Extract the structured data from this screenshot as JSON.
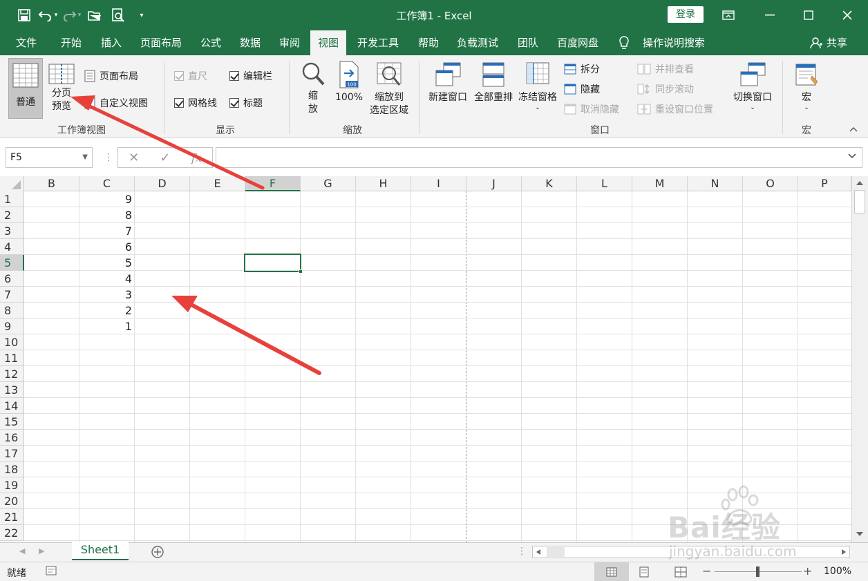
{
  "titlebar": {
    "title": "工作簿1  -  Excel",
    "login": "登录"
  },
  "tabs": [
    {
      "label": "文件"
    },
    {
      "label": "开始"
    },
    {
      "label": "插入"
    },
    {
      "label": "页面布局"
    },
    {
      "label": "公式"
    },
    {
      "label": "数据"
    },
    {
      "label": "审阅"
    },
    {
      "label": "视图",
      "active": true
    },
    {
      "label": "开发工具"
    },
    {
      "label": "帮助"
    },
    {
      "label": "负载测试"
    },
    {
      "label": "团队"
    },
    {
      "label": "百度网盘"
    }
  ],
  "search_label": "操作说明搜索",
  "share_label": "共享",
  "ribbon": {
    "workbook_views": {
      "group_label": "工作簿视图",
      "normal": "普通",
      "page_break_1": "分页",
      "page_break_2": "预览",
      "page_layout": "页面布局",
      "custom_views": "自定义视图"
    },
    "show": {
      "group_label": "显示",
      "ruler": "直尺",
      "formula_bar": "编辑栏",
      "gridlines": "网格线",
      "headings": "标题"
    },
    "zoom": {
      "group_label": "缩放",
      "zoom_1": "缩",
      "zoom_2": "放",
      "hundred": "100%",
      "zoom_sel_1": "缩放到",
      "zoom_sel_2": "选定区域"
    },
    "window": {
      "group_label": "窗口",
      "new_window": "新建窗口",
      "arrange_all": "全部重排",
      "freeze_panes": "冻结窗格",
      "split": "拆分",
      "hide": "隐藏",
      "unhide": "取消隐藏",
      "side_by_side": "并排查看",
      "sync_scroll": "同步滚动",
      "reset_position": "重设窗口位置",
      "switch_windows": "切换窗口"
    },
    "macros": {
      "group_label": "宏",
      "macros": "宏"
    }
  },
  "formula_bar": {
    "name_box": "F5",
    "fx": "fx",
    "value": ""
  },
  "columns": [
    "B",
    "C",
    "D",
    "E",
    "F",
    "G",
    "H",
    "I",
    "J",
    "K",
    "L",
    "M",
    "N",
    "O",
    "P"
  ],
  "selected_column": "F",
  "rows": [
    "1",
    "2",
    "3",
    "4",
    "5",
    "6",
    "7",
    "8",
    "9",
    "10",
    "11",
    "12",
    "13",
    "14",
    "15",
    "16",
    "17",
    "18",
    "19",
    "20",
    "21",
    "22"
  ],
  "selected_row": "5",
  "column_c_values": [
    "9",
    "8",
    "7",
    "6",
    "5",
    "4",
    "3",
    "2",
    "1"
  ],
  "sheet_tab": "Sheet1",
  "status": {
    "ready": "就绪",
    "zoom": "100%"
  },
  "watermark": {
    "main": "Bai经验",
    "sub": "jingyan.baidu.com"
  },
  "colors": {
    "accent": "#217346",
    "arrow": "#e8413c"
  }
}
